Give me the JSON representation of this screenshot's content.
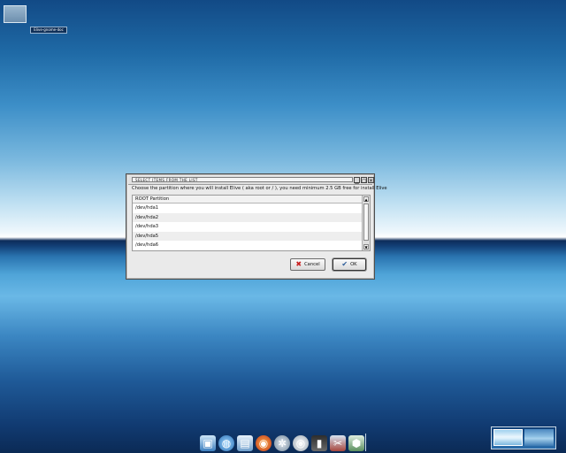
{
  "desktop": {
    "icon_label": "Elive-gnome-doc"
  },
  "dialog": {
    "title": "SELECT ITEMS FROM THE LIST",
    "instruction": "Choose the partition where you will install Elive ( aka root or / ), you need minimum 2.5 GB free for install Elive",
    "list_header": "ROOT Partition",
    "items": [
      "/dev/hda1",
      "/dev/hda2",
      "/dev/hda3",
      "/dev/hda5",
      "/dev/hda6"
    ],
    "cancel_label": "Cancel",
    "ok_label": "OK",
    "window_buttons": [
      "▁",
      "▢",
      "✕"
    ]
  },
  "dock": {
    "icons": [
      "monitor-icon",
      "globe-icon",
      "files-icon",
      "firefox-icon",
      "settings-icon",
      "media-icon",
      "terminal-icon",
      "tools-icon",
      "package-icon"
    ]
  },
  "colors": {
    "desktop_top": "#124a86",
    "horizon": "#ffffff",
    "dialog_bg": "#eaeaea"
  }
}
